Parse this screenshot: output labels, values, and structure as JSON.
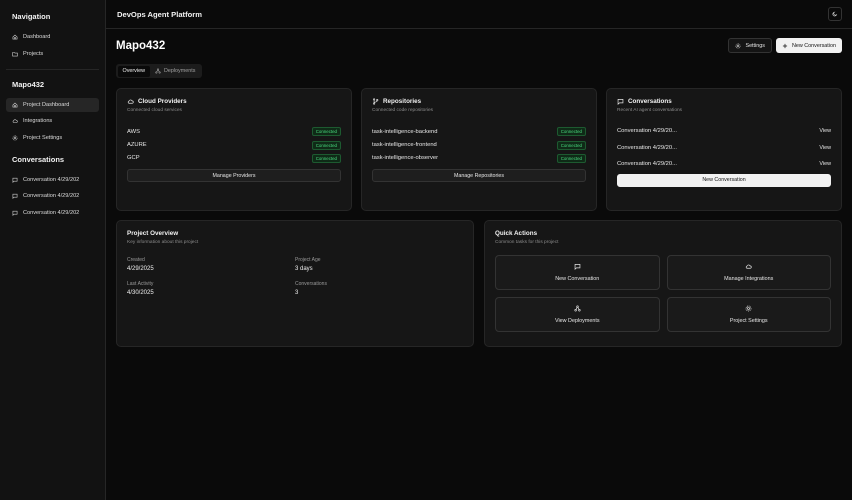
{
  "sidebar": {
    "nav_heading": "Navigation",
    "nav_items": [
      {
        "label": "Dashboard",
        "icon": "home-icon"
      },
      {
        "label": "Projects",
        "icon": "folder-icon"
      }
    ],
    "project_heading": "Mapo432",
    "project_items": [
      {
        "label": "Project Dashboard",
        "icon": "home-icon",
        "active": true
      },
      {
        "label": "Integrations",
        "icon": "cloud-icon"
      },
      {
        "label": "Project Settings",
        "icon": "gear-icon"
      }
    ],
    "conversations_heading": "Conversations",
    "conversation_items": [
      {
        "label": "Conversation 4/29/202"
      },
      {
        "label": "Conversation 4/29/202"
      },
      {
        "label": "Conversation 4/29/202"
      }
    ]
  },
  "header": {
    "app_title": "DevOps Agent Platform"
  },
  "page": {
    "title": "Mapo432",
    "settings_label": "Settings",
    "new_conversation_label": "New Conversation",
    "tabs": [
      {
        "label": "Overview",
        "active": true
      },
      {
        "label": "Deployments",
        "icon": "deployments-icon"
      }
    ]
  },
  "cloud_card": {
    "title": "Cloud Providers",
    "subtitle": "Connected cloud services",
    "rows": [
      {
        "name": "AWS",
        "status": "Connected"
      },
      {
        "name": "AZURE",
        "status": "Connected"
      },
      {
        "name": "GCP",
        "status": "Connected"
      }
    ],
    "button": "Manage Providers"
  },
  "repo_card": {
    "title": "Repositories",
    "subtitle": "Connected code repositories",
    "rows": [
      {
        "name": "task-intelligence-backend",
        "status": "Connected"
      },
      {
        "name": "task-intelligence-frontend",
        "status": "Connected"
      },
      {
        "name": "task-intelligence-observer",
        "status": "Connected"
      }
    ],
    "button": "Manage Repositories"
  },
  "conv_card": {
    "title": "Conversations",
    "subtitle": "Recent AI agent conversations",
    "rows": [
      {
        "name": "Conversation 4/29/20...",
        "action": "View"
      },
      {
        "name": "Conversation 4/29/20...",
        "action": "View"
      },
      {
        "name": "Conversation 4/29/20...",
        "action": "View"
      }
    ],
    "button": "New Conversation"
  },
  "overview_card": {
    "title": "Project Overview",
    "subtitle": "Key information about this project",
    "fields": [
      {
        "label": "Created",
        "value": "4/29/2025"
      },
      {
        "label": "Project Age",
        "value": "3 days"
      },
      {
        "label": "Last Activity",
        "value": "4/30/2025"
      },
      {
        "label": "Conversations",
        "value": "3"
      }
    ]
  },
  "quick_actions": {
    "title": "Quick Actions",
    "subtitle": "Common tasks for this project",
    "actions": [
      {
        "label": "New Conversation",
        "icon": "message-icon"
      },
      {
        "label": "Manage Integrations",
        "icon": "cloud-icon"
      },
      {
        "label": "View Deployments",
        "icon": "deployments-icon"
      },
      {
        "label": "Project Settings",
        "icon": "gear-icon"
      }
    ]
  },
  "colors": {
    "background": "#0a0a0a",
    "card": "#161616",
    "border": "#262626",
    "connected_text": "#4ade80",
    "connected_bg": "#0f2a17"
  }
}
